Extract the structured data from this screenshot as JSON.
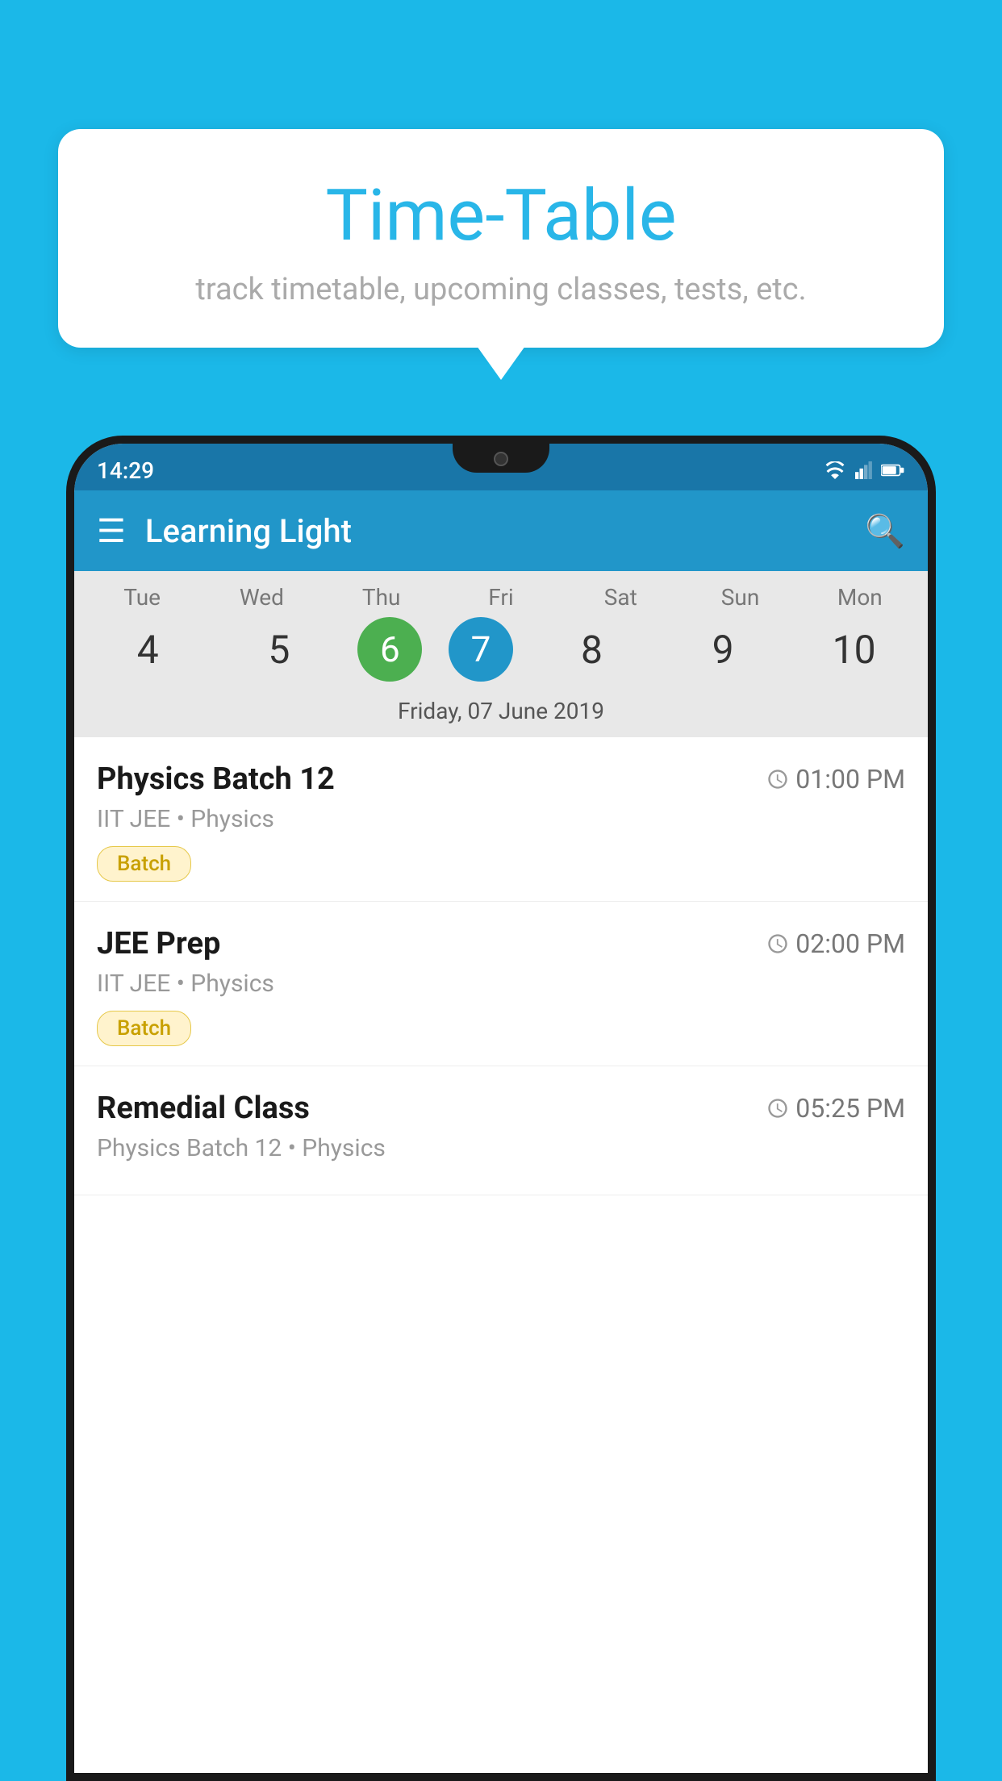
{
  "background_color": "#1bb8e8",
  "speech_bubble": {
    "title": "Time-Table",
    "subtitle": "track timetable, upcoming classes, tests, etc."
  },
  "phone": {
    "status_bar": {
      "time": "14:29"
    },
    "app_bar": {
      "title": "Learning Light"
    },
    "calendar": {
      "days": [
        {
          "label": "Tue",
          "number": "4"
        },
        {
          "label": "Wed",
          "number": "5"
        },
        {
          "label": "Thu",
          "number": "6",
          "type": "today-green"
        },
        {
          "label": "Fri",
          "number": "7",
          "type": "today-blue"
        },
        {
          "label": "Sat",
          "number": "8"
        },
        {
          "label": "Sun",
          "number": "9"
        },
        {
          "label": "Mon",
          "number": "10"
        }
      ],
      "selected_date": "Friday, 07 June 2019"
    },
    "schedule": [
      {
        "title": "Physics Batch 12",
        "time": "01:00 PM",
        "subtitle": "IIT JEE • Physics",
        "badge": "Batch"
      },
      {
        "title": "JEE Prep",
        "time": "02:00 PM",
        "subtitle": "IIT JEE • Physics",
        "badge": "Batch"
      },
      {
        "title": "Remedial Class",
        "time": "05:25 PM",
        "subtitle": "Physics Batch 12 • Physics",
        "badge": null
      }
    ]
  }
}
